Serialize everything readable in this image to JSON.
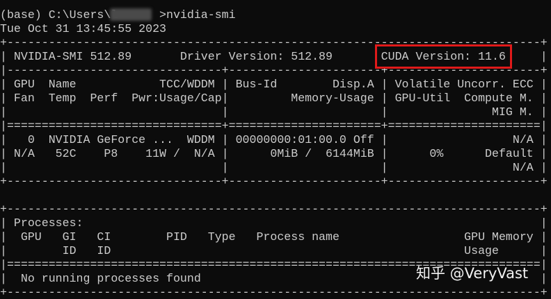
{
  "lines": [
    "(base) C:\\Users\\l      >nvidia-smi",
    "Tue Oct 31 13:45:55 2023",
    "+-----------------------------------------------------------------------------+",
    "| NVIDIA-SMI 512.89       Driver Version: 512.89       CUDA Version: 11.6     |",
    "|-------------------------------+----------------------+----------------------+",
    "| GPU  Name            TCC/WDDM | Bus-Id        Disp.A | Volatile Uncorr. ECC |",
    "| Fan  Temp  Perf  Pwr:Usage/Cap|         Memory-Usage | GPU-Util  Compute M. |",
    "|                               |                      |               MIG M. |",
    "|===============================+======================+======================|",
    "|   0  NVIDIA GeForce ...  WDDM | 00000000:01:00.0 Off |                  N/A |",
    "| N/A   52C    P8    11W /  N/A |      0MiB /  6144MiB |      0%      Default |",
    "|                               |                      |                  N/A |",
    "+-------------------------------+----------------------+----------------------+",
    "",
    "+-----------------------------------------------------------------------------+",
    "| Processes:                                                                  |",
    "|  GPU   GI   CI        PID   Type   Process name                  GPU Memory |",
    "|        ID   ID                                                   Usage      |",
    "|=============================================================================|",
    "|  No running processes found                                                 |",
    "+-----------------------------------------------------------------------------+"
  ],
  "watermark": "知乎 @VeryVast",
  "colors": {
    "background": "#0c0c0c",
    "text": "#cccccc",
    "highlight_border": "#e01a1a"
  }
}
